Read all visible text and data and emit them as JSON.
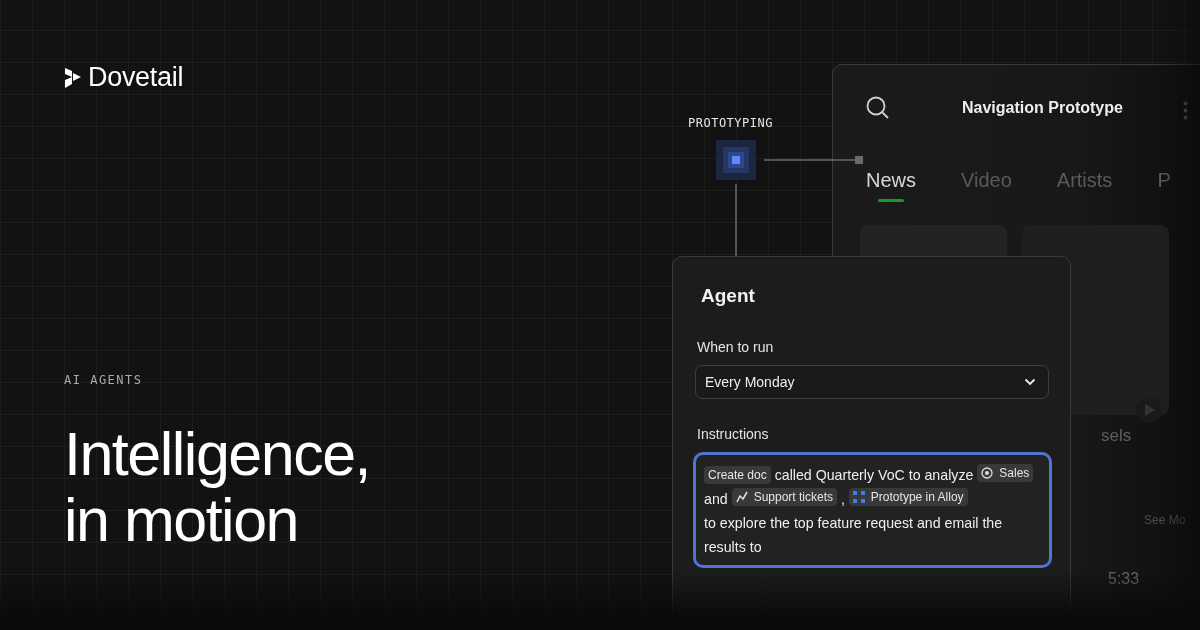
{
  "brand": {
    "name": "Dovetail"
  },
  "hero": {
    "eyebrow": "AI AGENTS",
    "headline_lines": [
      "Intelligence,",
      "in motion"
    ]
  },
  "node": {
    "label": "PROTOTYPING"
  },
  "proto": {
    "title": "Navigation Prototype",
    "tabs": [
      {
        "label": "News",
        "selected": true
      },
      {
        "label": "Video",
        "selected": false
      },
      {
        "label": "Artists",
        "selected": false
      },
      {
        "label": "P",
        "selected": false
      }
    ],
    "card_caption": "sels",
    "link": "See Mo",
    "duration": "5:33"
  },
  "agent": {
    "title": "Agent",
    "schedule_label": "When to run",
    "schedule_value": "Every Monday",
    "instructions_label": "Instructions",
    "instructions": [
      {
        "kind": "label",
        "text": "Create doc"
      },
      {
        "kind": "text",
        "text": "called Quarterly VoC to analyze"
      },
      {
        "kind": "source",
        "text": "Sales"
      },
      {
        "kind": "text",
        "text": "and"
      },
      {
        "kind": "trend",
        "text": "Support tickets"
      },
      {
        "kind": "text",
        "text": ","
      },
      {
        "kind": "prototype",
        "text": "Prototype in Alloy"
      },
      {
        "kind": "text",
        "text": "to explore the top feature request and email the results to"
      }
    ]
  }
}
